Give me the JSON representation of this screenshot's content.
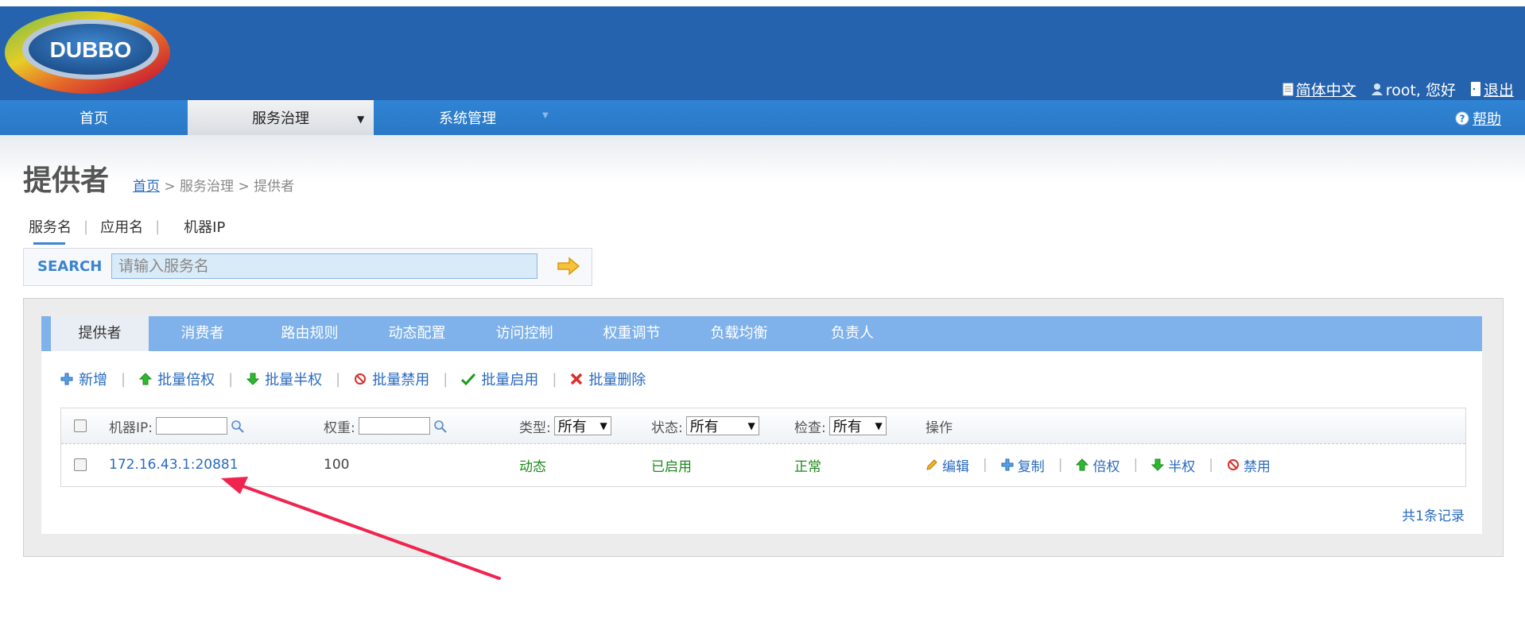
{
  "header": {
    "logo_text": "DUBBO",
    "language": "简体中文",
    "greeting": "root, 您好",
    "logout": "退出"
  },
  "nav": {
    "items": [
      {
        "label": "首页"
      },
      {
        "label": "服务治理"
      },
      {
        "label": "系统管理"
      }
    ],
    "help": "帮助"
  },
  "page": {
    "title": "提供者",
    "breadcrumb": {
      "home": "首页",
      "rest": "> 服务治理 > 提供者"
    }
  },
  "search": {
    "tabs": [
      "服务名",
      "应用名",
      "机器IP"
    ],
    "label": "SEARCH",
    "placeholder": "请输入服务名"
  },
  "tabs": [
    "提供者",
    "消费者",
    "路由规则",
    "动态配置",
    "访问控制",
    "权重调节",
    "负载均衡",
    "负责人"
  ],
  "toolbar": {
    "add": "新增",
    "batch_double": "批量倍权",
    "batch_half": "批量半权",
    "batch_disable": "批量禁用",
    "batch_enable": "批量启用",
    "batch_delete": "批量删除"
  },
  "table": {
    "headers": {
      "ip": "机器IP:",
      "weight": "权重:",
      "type": "类型:",
      "status": "状态:",
      "check": "检查:",
      "ops": "操作"
    },
    "filter_values": {
      "type": "所有",
      "status": "所有",
      "check": "所有"
    },
    "rows": [
      {
        "ip": "172.16.43.1:20881",
        "weight": "100",
        "type": "动态",
        "status": "已启用",
        "check": "正常",
        "ops": [
          "编辑",
          "复制",
          "倍权",
          "半权",
          "禁用"
        ]
      }
    ],
    "total": "共1条记录"
  },
  "colors": {
    "header_bg": "#2563ae",
    "nav_bg": "#2a78c7",
    "tab_bar": "#7fb2ea",
    "link": "#2a6bbf",
    "ok_green": "#1c8a1c",
    "annotation_arrow": "#f0244f"
  }
}
